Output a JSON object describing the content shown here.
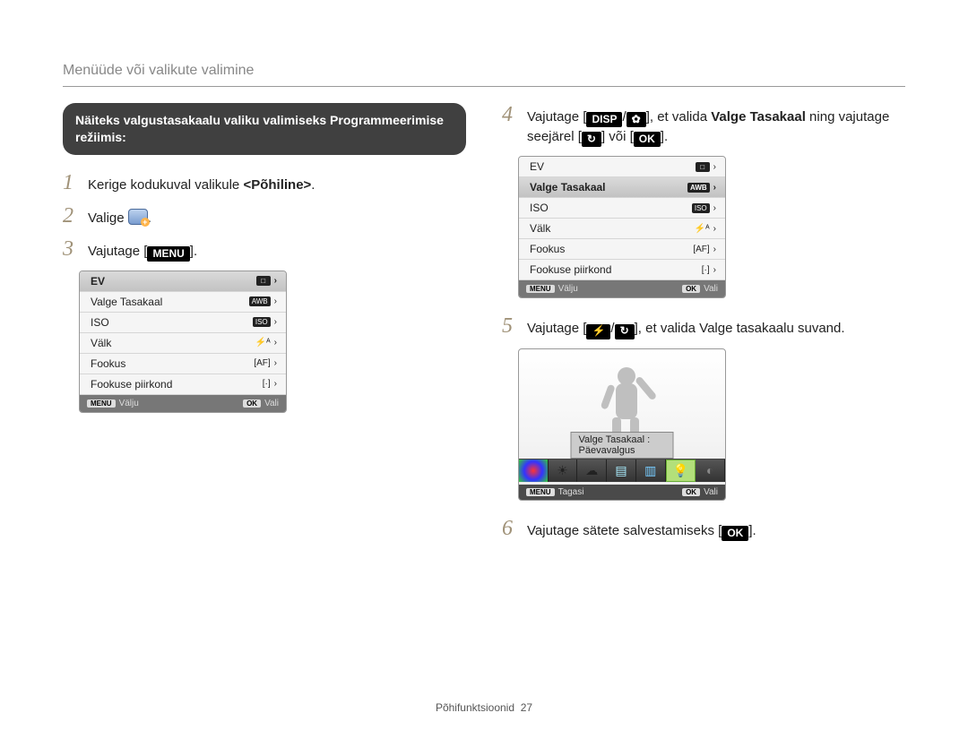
{
  "header": "Menüüde või valikute valimine",
  "intro": "Näiteks valgustasakaalu valiku valimiseks Programmeerimise režiimis:",
  "lcd_menu": {
    "items": [
      {
        "label": "EV",
        "badge": "□",
        "suffix": "›"
      },
      {
        "label": "Valge Tasakaal",
        "badge": "AWB",
        "suffix": "›"
      },
      {
        "label": "ISO",
        "badge": "ISO",
        "suffix": "›"
      },
      {
        "label": "Välk",
        "badge": "⚡ᴬ",
        "suffix": "›"
      },
      {
        "label": "Fookus",
        "badge": "[AF]",
        "suffix": "›"
      },
      {
        "label": "Fookuse piirkond",
        "badge": "[·]",
        "suffix": "›"
      }
    ],
    "footer_left_btn": "MENU",
    "footer_left": "Välju",
    "footer_right_btn": "OK",
    "footer_right": "Vali"
  },
  "wb_screen": {
    "label": "Valge Tasakaal : Päevavalgus",
    "footer_left_btn": "MENU",
    "footer_left": "Tagasi",
    "footer_right_btn": "OK",
    "footer_right": "Vali"
  },
  "left_steps": {
    "1": {
      "pre": "Kerige kodukuval valikule ",
      "bold": "<Põhiline>",
      "post": "."
    },
    "2": {
      "pre": "Valige ",
      "post": "."
    },
    "3": {
      "pre": "Vajutage [",
      "btn": "MENU",
      "post": "]."
    }
  },
  "right_steps": {
    "4": {
      "pre": "Vajutage [",
      "btn1": "DISP",
      "mid1": "/",
      "icon1": "✿",
      "mid2": "], et valida ",
      "bold": "Valge Tasakaal",
      "mid3": " ning vajutage seejärel [",
      "icon2": "↻",
      "mid4": "] või [",
      "btn2": "OK",
      "post": "]."
    },
    "5": {
      "pre": "Vajutage [",
      "icon1": "⚡",
      "mid1": "/",
      "icon2": "↻",
      "post": "], et valida Valge tasakaalu suvand."
    },
    "6": {
      "pre": "Vajutage sätete salvestamiseks [",
      "btn": "OK",
      "post": "]."
    }
  },
  "footer": {
    "section": "Põhifunktsioonid",
    "page": "27"
  }
}
